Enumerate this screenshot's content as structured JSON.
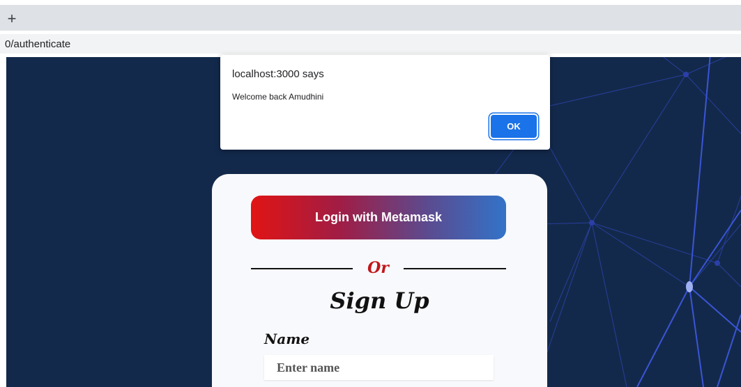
{
  "browser": {
    "new_tab_glyph": "+",
    "url": "0/authenticate"
  },
  "dialog": {
    "title": "localhost:3000 says",
    "message": "Welcome back Amudhini",
    "ok_label": "OK"
  },
  "card": {
    "metamask_button_label": "Login with Metamask",
    "divider_text": "Or",
    "signup_title": "Sign Up",
    "name_label": "Name",
    "name_placeholder": "Enter name",
    "metamask_gradient": [
      "#e11414",
      "#a01d45",
      "#5a4c91",
      "#3373c8"
    ]
  },
  "colors": {
    "page_background": "#13294b",
    "network_lines": "#3a55d6",
    "dialog_button": "#1a73e8",
    "divider_text": "#c0171b"
  },
  "icons": {
    "new_tab": "plus-icon"
  }
}
